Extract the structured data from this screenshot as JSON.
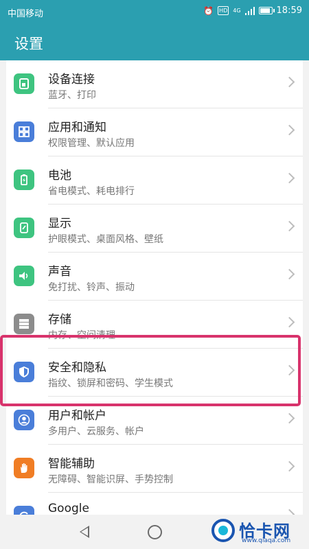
{
  "status_bar": {
    "carrier": "中国移动",
    "hd_badge": "HD",
    "network": "4G",
    "time": "18:59",
    "icons": [
      "alarm-icon",
      "hd-icon",
      "signal-icon",
      "battery-icon"
    ]
  },
  "app_bar": {
    "title": "设置"
  },
  "colors": {
    "header": "#2b9fb0",
    "highlight": "#d8336c",
    "watermark": "#1a55b0"
  },
  "settings": [
    {
      "title": "设备连接",
      "subtitle": "蓝牙、打印",
      "icon": "device-connect-icon",
      "color": "#3ec480"
    },
    {
      "title": "应用和通知",
      "subtitle": "权限管理、默认应用",
      "icon": "apps-grid-icon",
      "color": "#4a7ed9"
    },
    {
      "title": "电池",
      "subtitle": "省电模式、耗电排行",
      "icon": "battery-icon",
      "color": "#3ec480"
    },
    {
      "title": "显示",
      "subtitle": "护眼模式、桌面风格、壁纸",
      "icon": "display-icon",
      "color": "#3ec480"
    },
    {
      "title": "声音",
      "subtitle": "免打扰、铃声、振动",
      "icon": "volume-icon",
      "color": "#3ec480"
    },
    {
      "title": "存储",
      "subtitle": "内存、空间清理",
      "icon": "storage-icon",
      "color": "#8c8c8c"
    },
    {
      "title": "安全和隐私",
      "subtitle": "指纹、锁屏和密码、学生模式",
      "icon": "shield-icon",
      "color": "#4a7ed9"
    },
    {
      "title": "用户和帐户",
      "subtitle": "多用户、云服务、帐户",
      "icon": "user-icon",
      "color": "#4a7ed9"
    },
    {
      "title": "智能辅助",
      "subtitle": "无障碍、智能识屏、手势控制",
      "icon": "hand-icon",
      "color": "#f07d24"
    },
    {
      "title": "Google",
      "subtitle": "",
      "icon": "google-icon",
      "color": "#4a7ed9"
    }
  ],
  "watermark": {
    "text": "恰卡网",
    "sub": "www.qiaqa.com"
  }
}
